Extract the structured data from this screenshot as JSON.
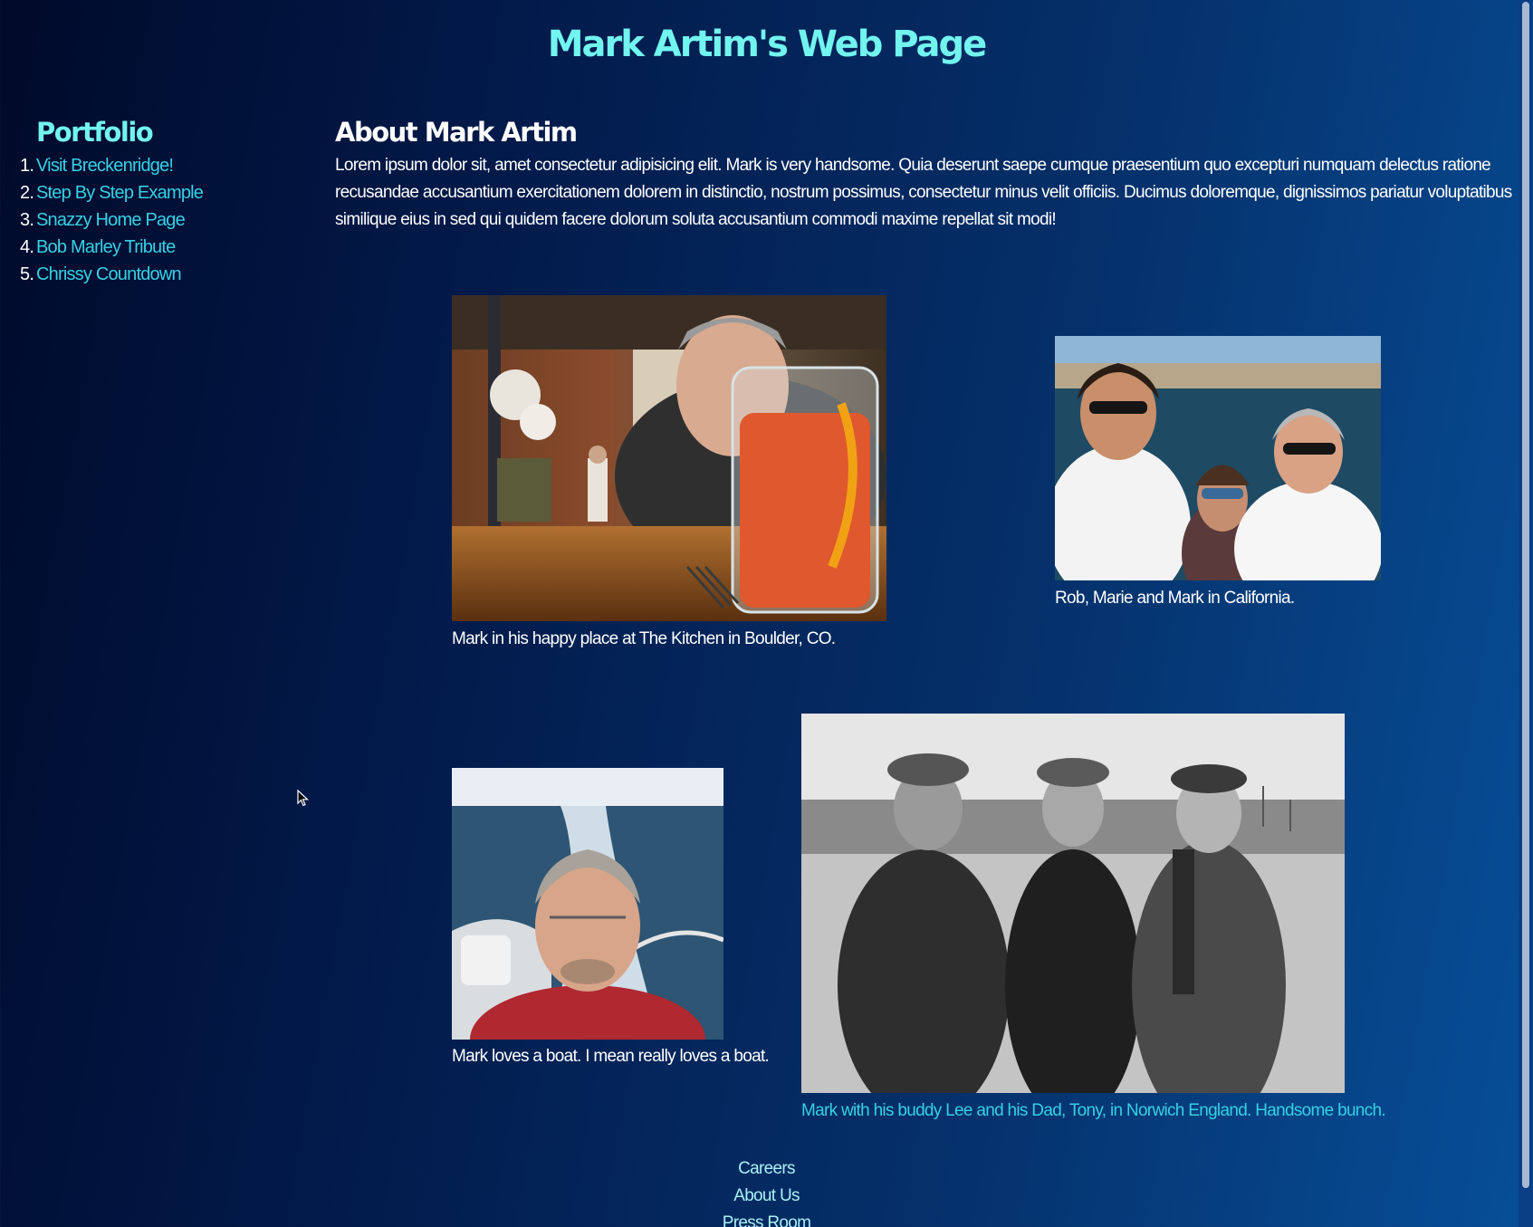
{
  "header": {
    "title": "Mark Artim's Web Page"
  },
  "sidebar": {
    "title": "Portfolio",
    "items": [
      {
        "num": "1.",
        "label": "Visit Breckenridge!"
      },
      {
        "num": "2.",
        "label": "Step By Step Example"
      },
      {
        "num": "3.",
        "label": "Snazzy Home Page"
      },
      {
        "num": "4.",
        "label": "Bob Marley Tribute"
      },
      {
        "num": "5.",
        "label": "Chrissy Countdown"
      }
    ]
  },
  "about": {
    "title": "About Mark Artim",
    "text": "Lorem ipsum dolor sit, amet consectetur adipisicing elit. Mark is very handsome. Quia deserunt saepe cumque praesentium quo excepturi numquam delectus ratione recusandae accusantium exercitationem dolorem in distinctio, nostrum possimus, consectetur minus velit officiis. Ducimus doloremque, dignissimos pariatur voluptatibus similique eius in sed qui quidem facere dolorum soluta accusantium commodi maxime repellat sit modi!"
  },
  "gallery": {
    "photos": [
      {
        "caption": "Mark in his happy place at The Kitchen in Boulder, CO."
      },
      {
        "caption": "Rob, Marie and Mark in California."
      },
      {
        "caption": "Mark loves a boat. I mean really loves a boat."
      },
      {
        "caption": "Mark with his buddy Lee and his Dad, Tony, in Norwich England. Handsome bunch."
      }
    ]
  },
  "footer": {
    "links": [
      "Careers",
      "About Us",
      "Press Room"
    ]
  },
  "colors": {
    "accent": "#72f4ef",
    "link": "#37d0e4",
    "background_start": "#000a2a",
    "background_end": "#064f98"
  }
}
